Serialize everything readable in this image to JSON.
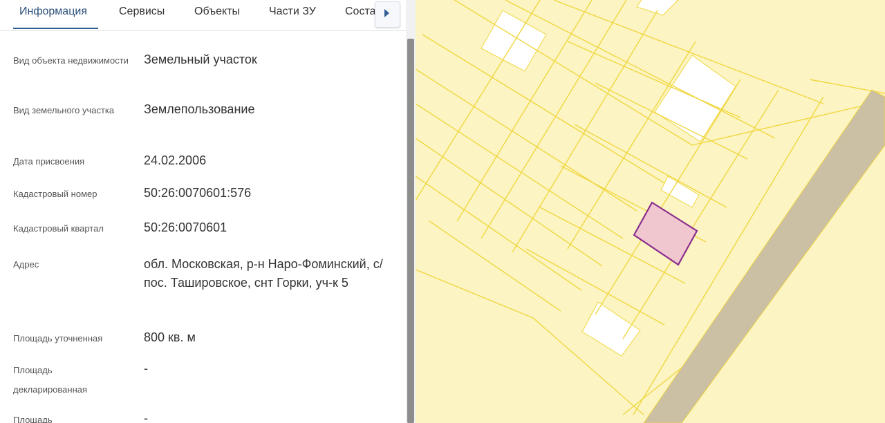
{
  "tabs": [
    {
      "label": "Информация",
      "active": true
    },
    {
      "label": "Сервисы"
    },
    {
      "label": "Объекты"
    },
    {
      "label": "Части ЗУ"
    },
    {
      "label": "Соста"
    }
  ],
  "tab_next_icon": "chevron-right-icon",
  "fields": [
    {
      "label": "Вид объекта недвижимости",
      "value": "Земельный участок"
    },
    {
      "label": "Вид земельного участка",
      "value": "Землепользование"
    },
    {
      "label": "Дата присвоения",
      "value": "24.02.2006"
    },
    {
      "label": "Кадастровый номер",
      "value": "50:26:0070601:576"
    },
    {
      "label": "Кадастровый квартал",
      "value": "50:26:0070601"
    },
    {
      "label": "Адрес",
      "value": "обл. Московская, р-н Наро-Фоминский, с/пос. Таширoвское, снт Горки, уч-к 5"
    },
    {
      "label": "Площадь уточненная",
      "value": "800 кв. м"
    },
    {
      "label": "Площадь декларированная",
      "value": "-"
    },
    {
      "label": "Площадь",
      "value": "-"
    }
  ],
  "colors": {
    "accent": "#2f5f93",
    "map_background": "#fcf5c3",
    "parcel_line": "#f0d640",
    "road": "#cbbfa4",
    "selected_parcel_fill": "#f0c6cf",
    "selected_parcel_stroke": "#8a2d8d"
  }
}
